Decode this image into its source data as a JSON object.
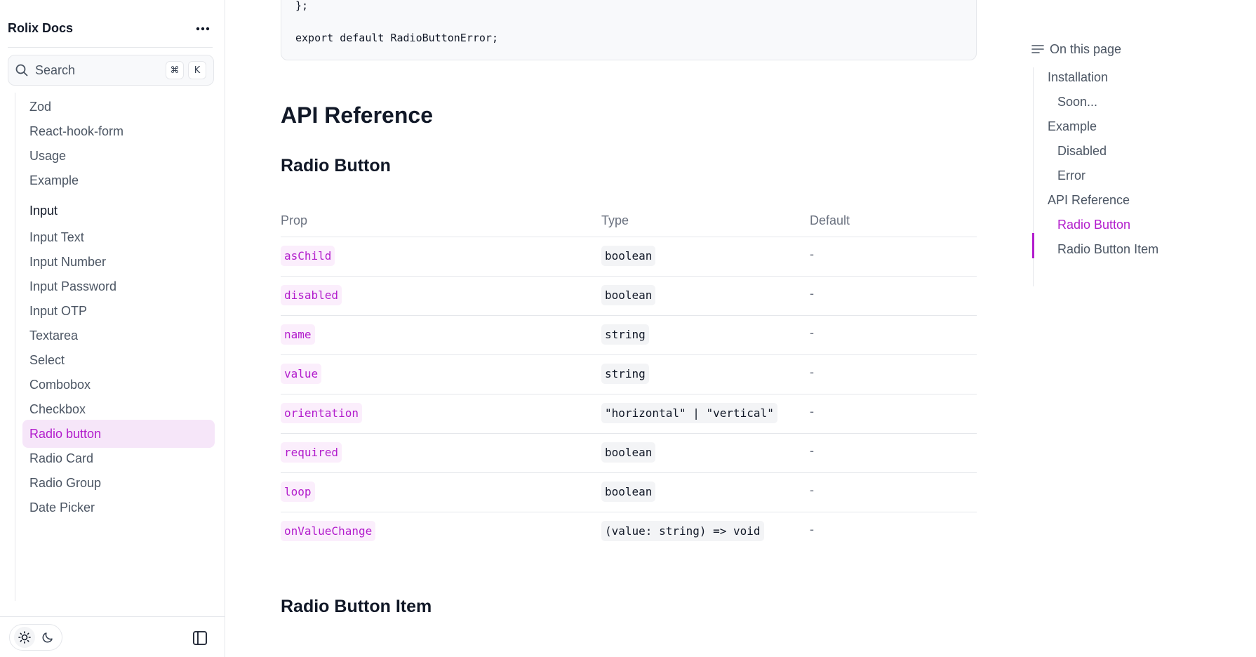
{
  "sidebar": {
    "brand": "Rolix Docs",
    "more_icon": "more-horizontal-icon",
    "search": {
      "placeholder": "Search",
      "shortcut_mod": "⌘",
      "shortcut_key": "K"
    },
    "items_top": [
      {
        "label": "Zod"
      },
      {
        "label": "React-hook-form"
      },
      {
        "label": "Usage"
      },
      {
        "label": "Example"
      }
    ],
    "section_heading": "Input",
    "items": [
      {
        "label": "Input Text"
      },
      {
        "label": "Input Number"
      },
      {
        "label": "Input Password"
      },
      {
        "label": "Input OTP"
      },
      {
        "label": "Textarea"
      },
      {
        "label": "Select"
      },
      {
        "label": "Combobox"
      },
      {
        "label": "Checkbox"
      },
      {
        "label": "Radio button",
        "active": true
      },
      {
        "label": "Radio Card"
      },
      {
        "label": "Radio Group"
      },
      {
        "label": "Date Picker"
      }
    ],
    "footer": {
      "light_icon": "sun-icon",
      "dark_icon": "moon-icon",
      "panel_icon": "sidebar-toggle-icon"
    }
  },
  "main": {
    "code_lines": [
      "};",
      "",
      "export default RadioButtonError;"
    ],
    "api_title": "API Reference",
    "section1_title": "Radio Button",
    "section2_title": "Radio Button Item",
    "table": {
      "headers": [
        "Prop",
        "Type",
        "Default"
      ],
      "rows": [
        {
          "prop": "asChild",
          "type": "boolean",
          "default": "-"
        },
        {
          "prop": "disabled",
          "type": "boolean",
          "default": "-"
        },
        {
          "prop": "name",
          "type": "string",
          "default": "-"
        },
        {
          "prop": "value",
          "type": "string",
          "default": "-"
        },
        {
          "prop": "orientation",
          "type": "\"horizontal\" | \"vertical\"",
          "default": "-"
        },
        {
          "prop": "required",
          "type": "boolean",
          "default": "-"
        },
        {
          "prop": "loop",
          "type": "boolean",
          "default": "-"
        },
        {
          "prop": "onValueChange",
          "type": "(value: string) => void",
          "default": "-"
        }
      ]
    }
  },
  "toc": {
    "title": "On this page",
    "items": [
      {
        "label": "Installation",
        "level": 1
      },
      {
        "label": "Soon...",
        "level": 2
      },
      {
        "label": "Example",
        "level": 1
      },
      {
        "label": "Disabled",
        "level": 2
      },
      {
        "label": "Error",
        "level": 2
      },
      {
        "label": "API Reference",
        "level": 1
      },
      {
        "label": "Radio Button",
        "level": 2,
        "active": true
      },
      {
        "label": "Radio Button Item",
        "level": 2
      }
    ]
  },
  "colors": {
    "accent": "#b21ccc",
    "accent_bg": "#f6e6f9",
    "border": "#e5e7eb",
    "muted_text": "#4b5563"
  }
}
